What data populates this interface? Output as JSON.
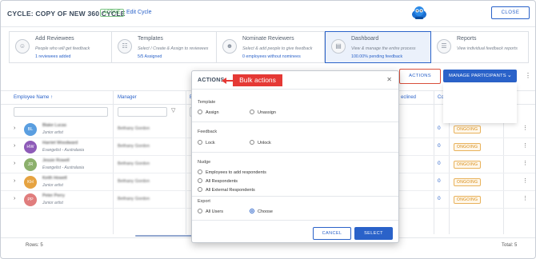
{
  "header": {
    "title": "CYCLE: COPY OF NEW 360 CYCLE",
    "status_badge": "ACTIVE",
    "edit_link": "Edit Cycle",
    "close_label": "CLOSE"
  },
  "steps": [
    {
      "icon": "add-user-icon",
      "title": "Add Reviewees",
      "subtitle": "People who will get feedback",
      "status": "1 reviewees added"
    },
    {
      "icon": "templates-icon",
      "title": "Templates",
      "subtitle": "Select / Create & Assign to reviewees",
      "status": "5/5 Assigned"
    },
    {
      "icon": "nominate-icon",
      "title": "Nominate Reviewers",
      "subtitle": "Select & add people to give feedback",
      "status": "0 employees without nominees"
    },
    {
      "icon": "dashboard-icon",
      "title": "Dashboard",
      "subtitle": "View & manage the entire process",
      "status": "100.00% pending feedback"
    },
    {
      "icon": "reports-icon",
      "title": "Reports",
      "subtitle": "View individual feedback reports",
      "status": ""
    }
  ],
  "toolbar": {
    "actions_label": "ACTIONS",
    "manage_label": "MANAGE PARTICIPANTS",
    "annotation": "Bulk actions"
  },
  "table": {
    "columns": [
      "Employee Name",
      "Manager",
      "Em",
      "eclined",
      "Co"
    ],
    "rows": [
      {
        "initials": "BL",
        "color": "#5a9ee0",
        "name": "Blake Lucas",
        "role": "Junior artist",
        "manager": "Bethany Gordon",
        "count": "0",
        "status": "ONGOING"
      },
      {
        "initials": "HW",
        "color": "#8e5bb8",
        "name": "Harriet Woodward",
        "role": "Evangelist - Australasia",
        "manager": "Bethany Gordon",
        "count": "0",
        "status": "ONGOING"
      },
      {
        "initials": "JR",
        "color": "#8cb06c",
        "name": "Jessie Rowell",
        "role": "Evangelist - Australasia",
        "manager": "Bethany Gordon",
        "count": "0",
        "status": "ONGOING"
      },
      {
        "initials": "KH",
        "color": "#e6a341",
        "name": "Keith Howell",
        "role": "Junior artist",
        "manager": "Bethany Gordon",
        "count": "0",
        "status": "ONGOING"
      },
      {
        "initials": "PP",
        "color": "#e07d7d",
        "name": "Peter Perry",
        "role": "Junior artist",
        "manager": "Bethany Gordon",
        "count": "0",
        "status": "ONGOING"
      }
    ],
    "rows_label": "Rows: 5",
    "total_label": "Total: 5"
  },
  "modal": {
    "title": "ACTIONS",
    "sections": {
      "template": {
        "label": "Template",
        "options": [
          "Assign",
          "Unassign"
        ]
      },
      "feedback": {
        "label": "Feedback",
        "options": [
          "Lock",
          "Unlock"
        ]
      },
      "nudge": {
        "label": "Nudge",
        "options": [
          "Employees to add respondents",
          "All Respondents",
          "All External Respondents"
        ]
      },
      "export": {
        "label": "Export",
        "options": [
          "All Users",
          "Choose"
        ],
        "selected": "Choose"
      }
    },
    "cancel_label": "CANCEL",
    "select_label": "SELECT"
  },
  "colors": {
    "accent": "#2a62c9",
    "annotation": "#e53935",
    "status": "#d68a12"
  }
}
